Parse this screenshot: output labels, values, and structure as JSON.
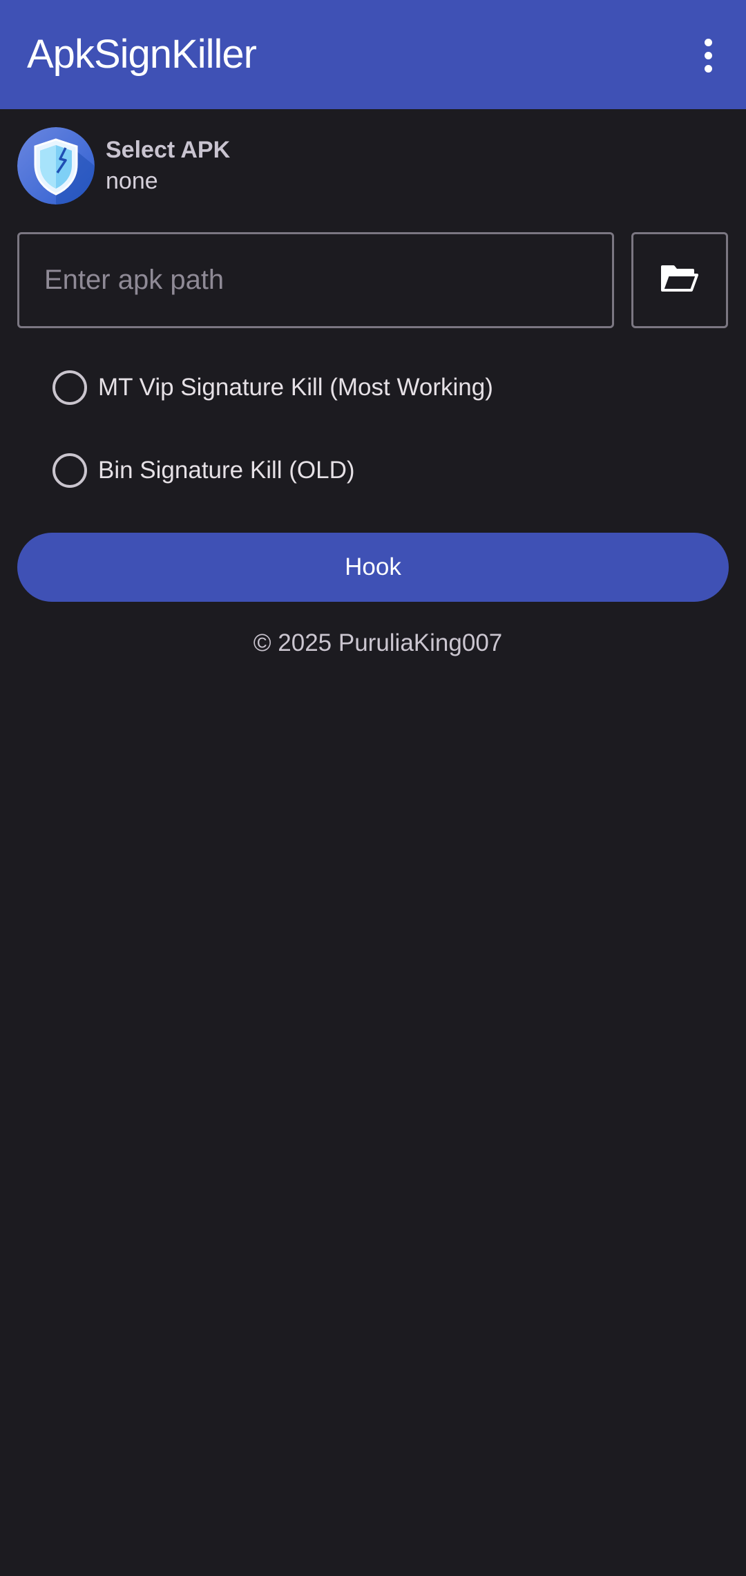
{
  "appbar": {
    "title": "ApkSignKiller",
    "color": "#3f51b5",
    "menu_icon": "more-vert-icon"
  },
  "apk": {
    "icon": "shield-icon",
    "label": "Select APK",
    "value": "none"
  },
  "path_input": {
    "value": "",
    "placeholder": "Enter apk path"
  },
  "browse_button": {
    "icon": "folder-open-icon"
  },
  "options": [
    {
      "label": "MT Vip Signature Kill (Most Working)",
      "selected": false
    },
    {
      "label": "Bin Signature Kill (OLD)",
      "selected": false
    }
  ],
  "hook_button": {
    "label": "Hook"
  },
  "footer": {
    "text": "© 2025 PuruliaKing007"
  },
  "colors": {
    "background": "#1c1b20",
    "accent": "#3f51b5"
  }
}
